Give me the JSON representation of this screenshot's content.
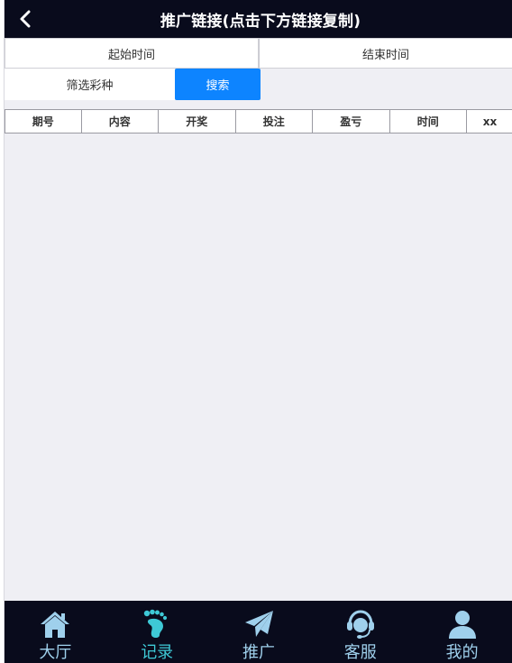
{
  "header": {
    "title": "推广链接(点击下方链接复制)"
  },
  "dates": {
    "start_label": "起始时间",
    "end_label": "结束时间"
  },
  "filter": {
    "lottery_label": "筛选彩种",
    "search_label": "搜索"
  },
  "table": {
    "columns": [
      "期号",
      "内容",
      "开奖",
      "投注",
      "盈亏",
      "时间",
      "xx"
    ]
  },
  "nav": {
    "items": [
      {
        "label": "大厅",
        "icon": "home-icon",
        "active": false
      },
      {
        "label": "记录",
        "icon": "footprint-icon",
        "active": true
      },
      {
        "label": "推广",
        "icon": "paper-plane-icon",
        "active": false
      },
      {
        "label": "客服",
        "icon": "headset-icon",
        "active": false
      },
      {
        "label": "我的",
        "icon": "user-icon",
        "active": false
      }
    ]
  },
  "colors": {
    "header_bg": "#090b1c",
    "accent_blue": "#0d84ff",
    "nav_icon": "#9fd0ec",
    "nav_active": "#3ec9d6",
    "page_bg": "#efeff4"
  }
}
